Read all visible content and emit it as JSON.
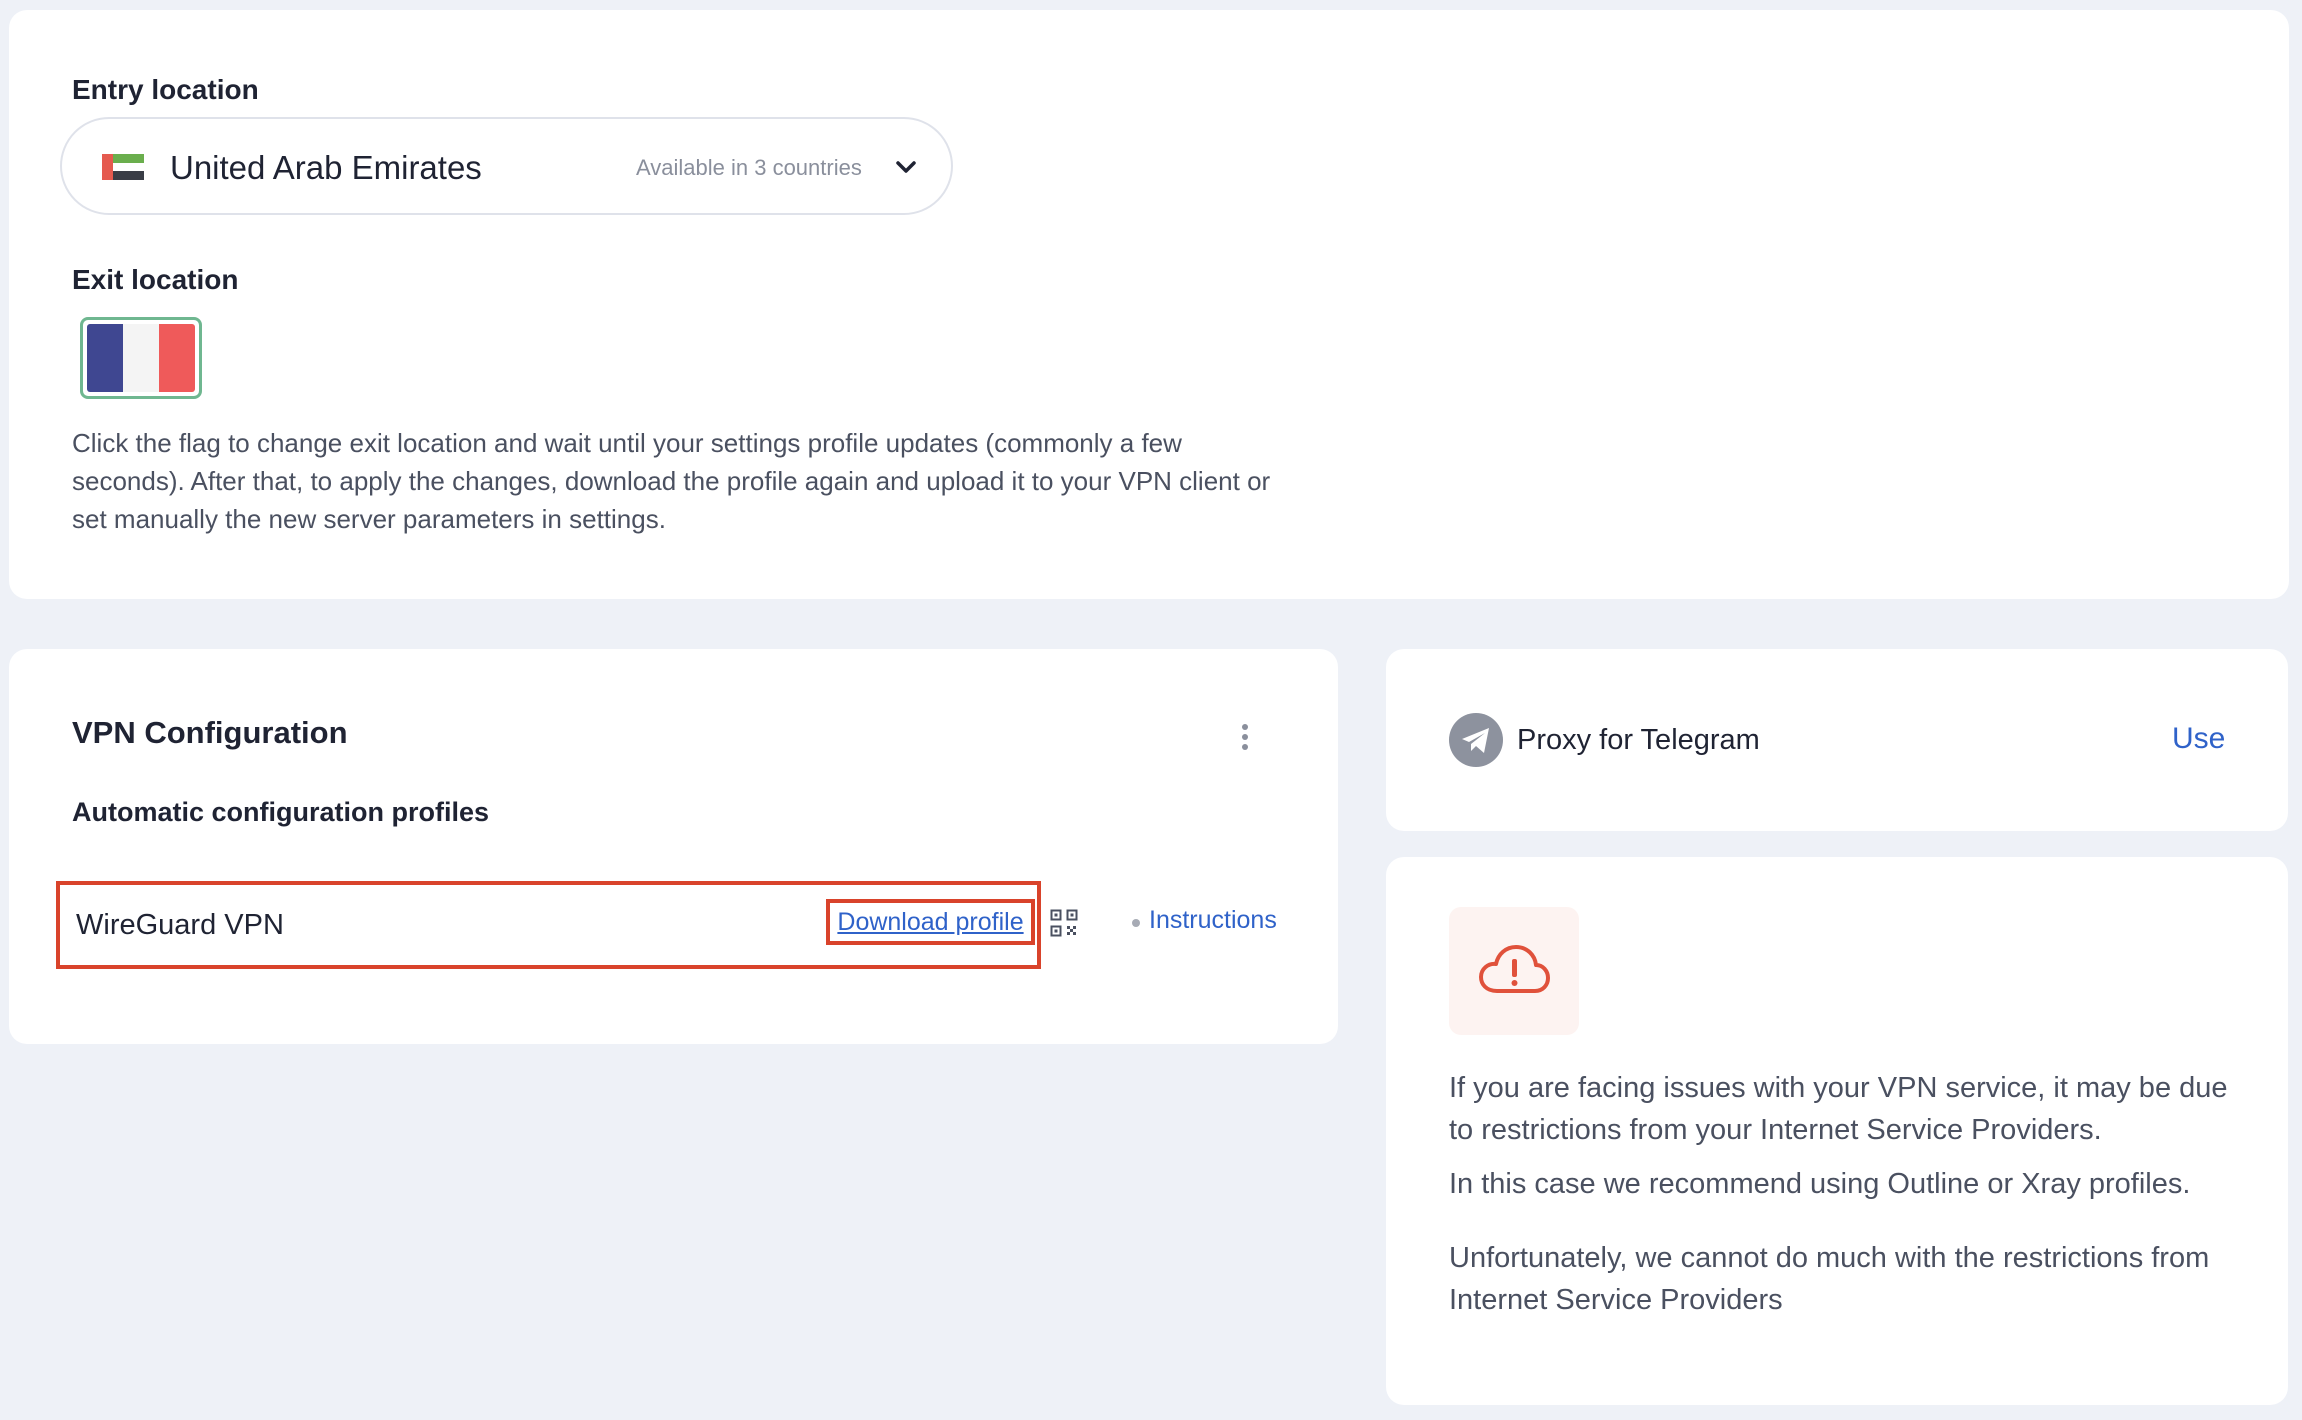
{
  "colors": {
    "accent": "#2f62c9",
    "highlight": "#d9432b",
    "warning": "#e0513b",
    "selected_border": "#6fb790"
  },
  "location": {
    "entry_label": "Entry location",
    "entry_country": "United Arab Emirates",
    "entry_availability": "Available in 3 countries",
    "entry_flag_icon": "uae-flag-icon",
    "exit_label": "Exit location",
    "exit_flag_icon": "france-flag-icon",
    "hint": "Click the flag to change exit location and wait until your settings profile updates (commonly a few seconds). After that, to apply the changes, download the profile again and upload it to your VPN client or set manually the new server parameters in settings."
  },
  "vpn": {
    "title": "VPN Configuration",
    "subtitle": "Automatic configuration profiles",
    "profile_name": "WireGuard VPN",
    "download_label": "Download profile",
    "qr_icon": "qr-code-icon",
    "instructions_label": "Instructions"
  },
  "telegram": {
    "label": "Proxy for Telegram",
    "use_label": "Use",
    "icon": "telegram-icon"
  },
  "warning": {
    "icon": "cloud-alert-icon",
    "para1": "If you are facing issues with your VPN service, it may be due to restrictions from your Internet Service Providers.",
    "para2": "In this case we recommend using Outline or Xray profiles.",
    "para3": "Unfortunately, we cannot do much with the restrictions from Internet Service Providers"
  }
}
